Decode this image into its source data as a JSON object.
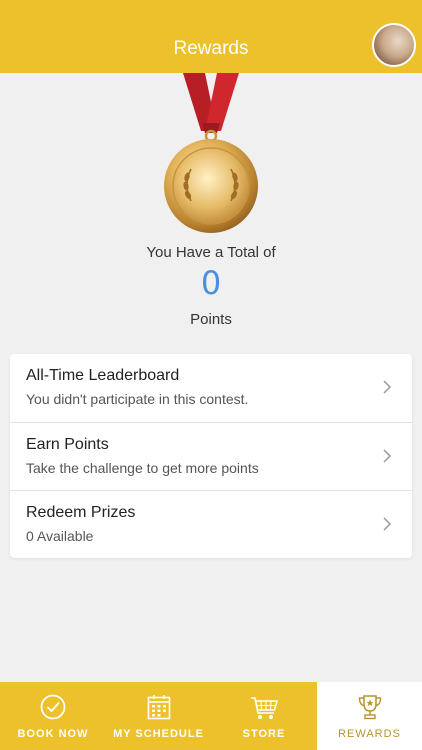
{
  "header": {
    "title": "Rewards"
  },
  "summary": {
    "total_label": "You Have a Total of",
    "points_value": "0",
    "points_label": "Points"
  },
  "menu": [
    {
      "title": "All-Time Leaderboard",
      "subtitle": "You didn't participate in this contest."
    },
    {
      "title": "Earn Points",
      "subtitle": "Take the challenge to get more points"
    },
    {
      "title": "Redeem Prizes",
      "subtitle": "0 Available"
    }
  ],
  "tabs": [
    {
      "label": "BOOK NOW",
      "icon": "check-circle-icon"
    },
    {
      "label": "MY SCHEDULE",
      "icon": "calendar-icon"
    },
    {
      "label": "STORE",
      "icon": "cart-icon"
    },
    {
      "label": "REWARDS",
      "icon": "trophy-icon",
      "active": true
    }
  ],
  "colors": {
    "accent": "#ecc12c",
    "points": "#4a90e2",
    "ribbon": "#d0262d"
  }
}
